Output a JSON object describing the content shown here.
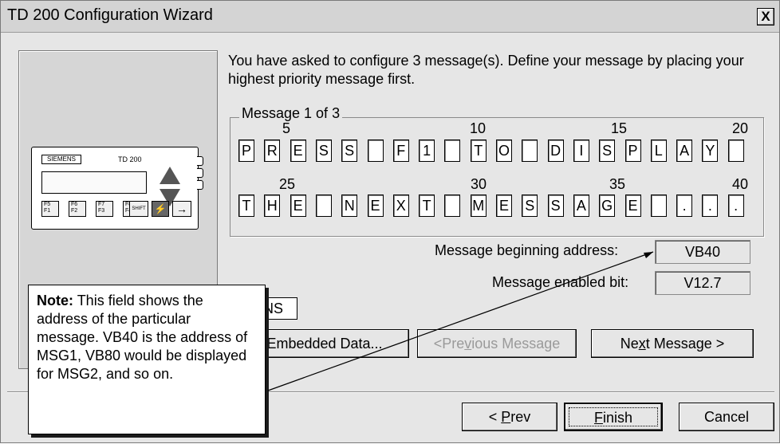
{
  "window": {
    "title": "TD 200 Configuration Wizard",
    "close_label": "X"
  },
  "device": {
    "brand": "SIEMENS",
    "model": "TD 200",
    "keys": [
      "F5\nF1",
      "F6\nF2",
      "F7\nF3",
      "F8\nF4"
    ],
    "shift_label": "SHIFT"
  },
  "intro_text": "You have asked to configure 3 message(s). Define your message by placing your highest priority message first.",
  "message_group": {
    "label": "Message 1 of 3",
    "row1_numbers": [
      "5",
      "10",
      "15",
      "20"
    ],
    "row2_numbers": [
      "25",
      "30",
      "35",
      "40"
    ],
    "row1_chars": [
      "P",
      "R",
      "E",
      "S",
      "S",
      " ",
      "F",
      "1",
      " ",
      "T",
      "O",
      " ",
      "D",
      "I",
      "S",
      "P",
      "L",
      "A",
      "Y",
      " "
    ],
    "row2_chars": [
      "T",
      "H",
      "E",
      " ",
      "N",
      "E",
      "X",
      "T",
      " ",
      "M",
      "E",
      "S",
      "S",
      "A",
      "G",
      "E",
      " ",
      ".",
      ".",
      "."
    ],
    "beginning_address_label": "Message beginning address:",
    "beginning_address_value": "VB40",
    "enabled_bit_label": "Message enabled bit:",
    "enabled_bit_value": "V12.7"
  },
  "partial_field": "NS",
  "buttons": {
    "embedded_data": "Embedded Data...",
    "previous_message": "<Previous Message",
    "next_message": "Next Message >",
    "prev": "< Prev",
    "finish": "Finish",
    "cancel": "Cancel"
  },
  "note": {
    "bold": "Note:",
    "text": "This field shows the address of the particular message. VB40 is the address of MSG1, VB80 would be displayed for MSG2, and so on."
  }
}
